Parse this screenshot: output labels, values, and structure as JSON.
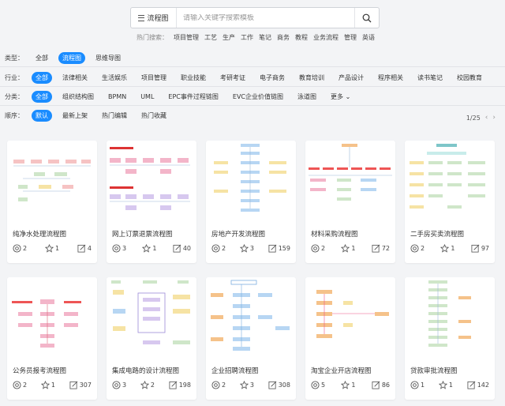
{
  "search": {
    "type_label": "流程图",
    "placeholder": "请输入关键字搜索模板"
  },
  "hot_search": {
    "label": "热门搜索：",
    "keywords": [
      "项目管理",
      "工艺",
      "生产",
      "工作",
      "笔记",
      "商务",
      "教程",
      "业务流程",
      "管理",
      "英语"
    ]
  },
  "filters": {
    "type": {
      "label": "类型：",
      "options": [
        "全部",
        "流程图",
        "思维导图"
      ]
    },
    "industry": {
      "label": "行业：",
      "options": [
        "全部",
        "法律相关",
        "生活娱乐",
        "项目管理",
        "职业技能",
        "考研考证",
        "电子商务",
        "教育培训",
        "产品设计",
        "程序相关",
        "读书笔记",
        "校园教育"
      ]
    },
    "category": {
      "label": "分类：",
      "options": [
        "全部",
        "组织结构图",
        "BPMN",
        "UML",
        "EPC事件过程链图",
        "EVC企业价值链图",
        "泳道图",
        "更多"
      ]
    },
    "sort": {
      "label": "顺序：",
      "options": [
        "默认",
        "最新上架",
        "热门编辑",
        "热门收藏"
      ]
    }
  },
  "pager": {
    "text": "1/25"
  },
  "icons": {
    "views": "eye-icon",
    "likes": "star-icon",
    "edits": "edit-icon",
    "search": "search-icon",
    "menu": "menu-icon"
  },
  "colors": {
    "accent": "#1a8cff"
  },
  "cards": [
    {
      "title": "纯净水处理流程图",
      "views": "2",
      "likes": "1",
      "edits": "4"
    },
    {
      "title": "网上订票退票流程图",
      "views": "3",
      "likes": "1",
      "edits": "40"
    },
    {
      "title": "房地产开发流程图",
      "views": "2",
      "likes": "3",
      "edits": "159"
    },
    {
      "title": "材料采购流程图",
      "views": "2",
      "likes": "1",
      "edits": "72"
    },
    {
      "title": "二手房买卖流程图",
      "views": "2",
      "likes": "1",
      "edits": "97"
    },
    {
      "title": "公务员报考流程图",
      "views": "2",
      "likes": "1",
      "edits": "307"
    },
    {
      "title": "集成电路的设计流程图",
      "views": "3",
      "likes": "2",
      "edits": "198"
    },
    {
      "title": "企业招聘流程图",
      "views": "2",
      "likes": "3",
      "edits": "308"
    },
    {
      "title": "淘宝企业开店流程图",
      "views": "5",
      "likes": "1",
      "edits": "86"
    },
    {
      "title": "贷款审批流程图",
      "views": "1",
      "likes": "1",
      "edits": "142"
    }
  ]
}
